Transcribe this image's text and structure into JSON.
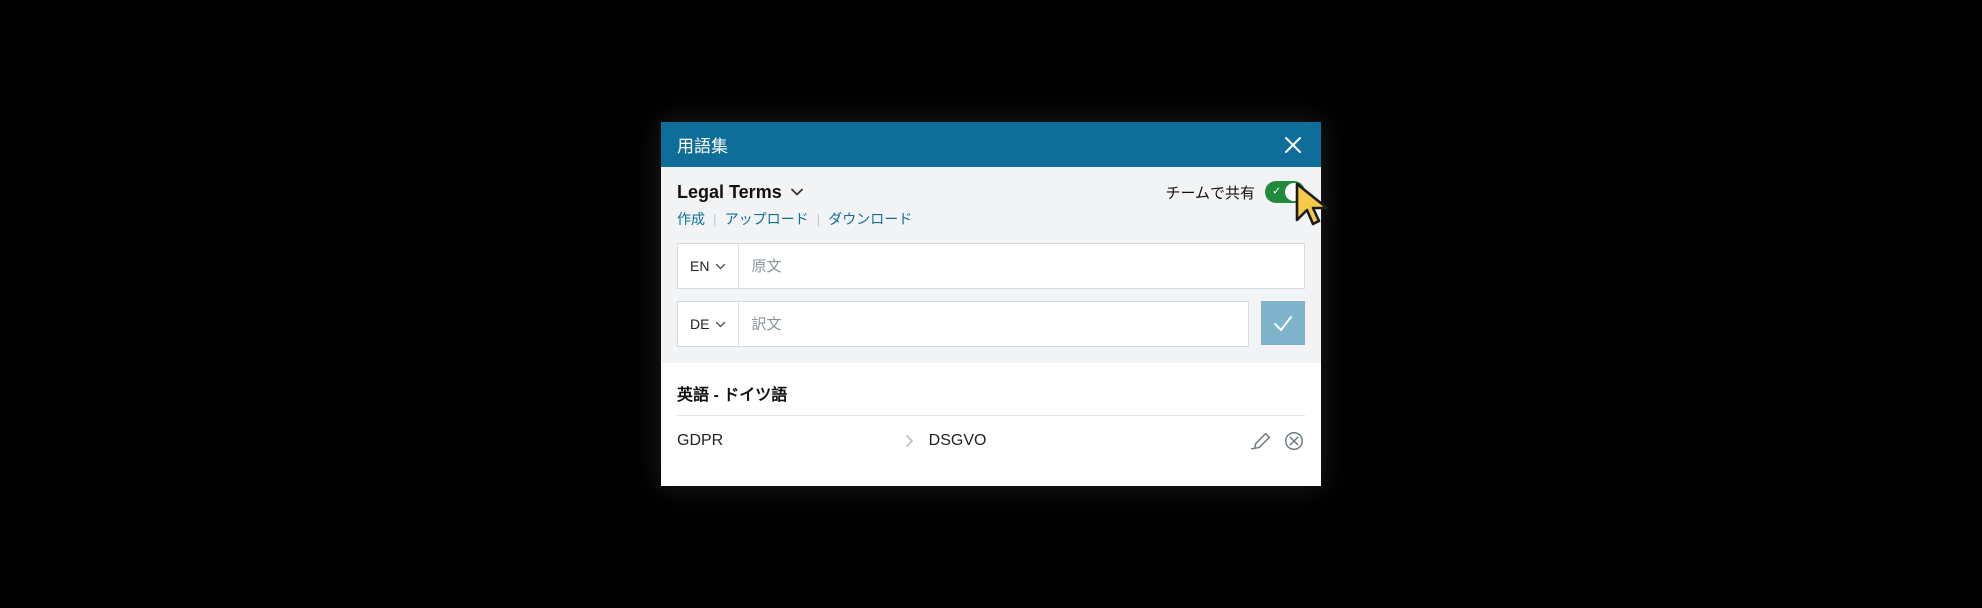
{
  "panel": {
    "title": "用語集"
  },
  "glossary": {
    "name": "Legal Terms",
    "share_label": "チームで共有",
    "share_on": true
  },
  "actions": {
    "create": "作成",
    "upload": "アップロード",
    "download": "ダウンロード"
  },
  "inputs": {
    "source_lang": "EN",
    "source_placeholder": "原文",
    "target_lang": "DE",
    "target_placeholder": "訳文"
  },
  "pair_heading": "英語 - ドイツ語",
  "entries": [
    {
      "src": "GDPR",
      "tgt": "DSGVO"
    }
  ],
  "colors": {
    "header_bg": "#0f6e99",
    "link": "#0f6e99",
    "switch_on": "#1f8b3b",
    "confirm_bg": "#7fb3cc"
  }
}
